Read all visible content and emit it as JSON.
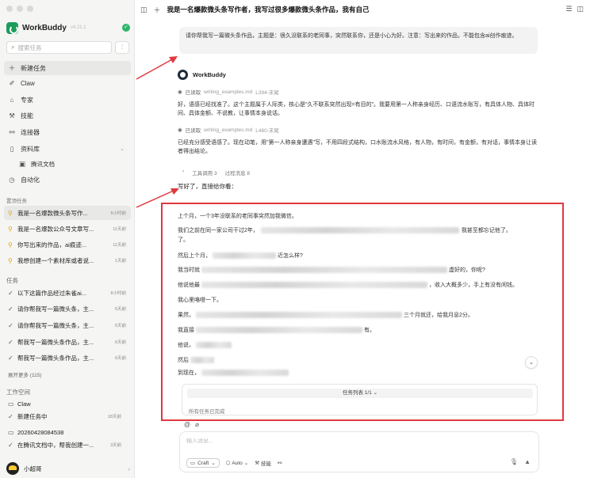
{
  "app": {
    "name": "WorkBuddy",
    "version": "v4.21.1"
  },
  "sidebar": {
    "search_placeholder": "搜索任务",
    "nav": [
      {
        "label": "新建任务",
        "icon": "plus-icon"
      },
      {
        "label": "Claw",
        "icon": "claw-icon"
      },
      {
        "label": "专家",
        "icon": "graduation-cap-icon"
      },
      {
        "label": "技能",
        "icon": "skill-icon"
      },
      {
        "label": "连接器",
        "icon": "connector-icon"
      },
      {
        "label": "资料库",
        "icon": "library-icon"
      },
      {
        "label": "腾讯文档",
        "icon": "tencent-docs-icon"
      },
      {
        "label": "自动化",
        "icon": "clock-icon"
      }
    ],
    "pinned_label": "置顶任务",
    "pinned": [
      {
        "title": "我是一名爆款微头条写作...",
        "time": "5小时前"
      },
      {
        "title": "我是一名爆款公众号文章写...",
        "time": "11天前"
      },
      {
        "title": "你写出来的作品，ai痕迹...",
        "time": "11天前"
      },
      {
        "title": "我想创建一个素材库或者说...",
        "time": "1天前"
      }
    ],
    "tasks_label": "任务",
    "tasks": [
      {
        "title": "以下这篇作品经过朱雀ai...",
        "time": "6小时前"
      },
      {
        "title": "请你帮我写一篇微头条，主...",
        "time": "5天前"
      },
      {
        "title": "请你帮我写一篇微头条，主...",
        "time": "5天前"
      },
      {
        "title": "帮我写一篇微头条作品，主...",
        "time": "6天前"
      },
      {
        "title": "帮我写一篇微头条作品，主...",
        "time": "6天前"
      }
    ],
    "expand_more": "展开更多 (115)",
    "workspace_label": "工作空间",
    "workspace": [
      {
        "title": "Claw",
        "time": "",
        "icon": "folder-icon"
      },
      {
        "title": "新建任务中",
        "time": "18天前",
        "icon": "check-icon"
      },
      {
        "title": "20260428084538",
        "time": "",
        "icon": "folder-icon"
      },
      {
        "title": "在腾讯文档中，帮我创建一...",
        "time": "3天前",
        "icon": "check-icon"
      }
    ],
    "user_name": "小超哥"
  },
  "header": {
    "title": "我是一名爆款微头条写作者，我写过很多爆款微头条作品，我有自己"
  },
  "chat": {
    "user_message": "请你帮我写一篇微头条作品，主题是：很久没联系的老同事，突然联系你，还是小心为好。注意：写出来的作品，不能包含ai创作痕迹。",
    "bot_name": "WorkBuddy",
    "read1_label": "已读取",
    "read1_file": "writing_examples.md",
    "read1_range": "L394-末尾",
    "para1": "好，语感已经找准了。这个主题属于人际类，核心是\"久不联系突然出现=有目的\"。我要用第一人称亲身经历、口语流水账写，有具体人物、具体时间、具体金额、不说教，让事情本身说话。",
    "read2_label": "已读取",
    "read2_file": "writing_examples.md",
    "read2_range": "L460-末尾",
    "para2": "已经充分感受语感了。现在动笔，用\"第一人称亲身遭遇\"写，不用四段式结构，口水账流水风格，有人物，有时间，有金额，有对话，事情本身让读者得出结论。",
    "tool_calls": "工具调用 3",
    "process_msgs": "过程消息 8",
    "ending": "写好了，直接给你看："
  },
  "draft": [
    {
      "before": "上个月，一个3年没联系的老同事突然加我微信。",
      "after": ""
    },
    {
      "before": "我们之前在同一家公司干过2年，",
      "after": "我甚至都忘记他了。"
    },
    {
      "before": "然后上个月，",
      "after": "近怎么样?"
    },
    {
      "before": "我当时就",
      "after": "虚好的，你呢?"
    },
    {
      "before": "他说他最",
      "after": "，收入大概多少，手上有没有闲钱。"
    },
    {
      "before": "我心里咯噔一下。",
      "after": ""
    },
    {
      "before": "果然，",
      "after": "三个月就还，给我月息2分。"
    },
    {
      "before": "我直接",
      "after": "有。"
    },
    {
      "before": "他说，",
      "after": ""
    },
    {
      "before": "然后",
      "after": ""
    },
    {
      "before": "到现在，",
      "after": ""
    }
  ],
  "task_panel": {
    "title": "任务列表 1/1",
    "status": "所有任务已完成"
  },
  "composer": {
    "placeholder": "输入消息...",
    "mode": "Craft",
    "model": "Auto",
    "skills": "技能"
  },
  "colors": {
    "accent_green": "#1c9c5b",
    "annotation_red": "#e0393e",
    "pinned_icon": "#e8a200"
  }
}
